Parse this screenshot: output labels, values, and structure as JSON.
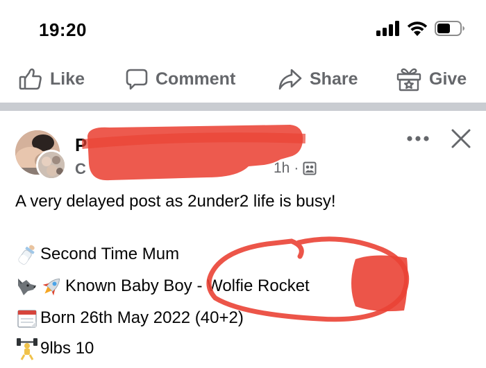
{
  "status_bar": {
    "time": "19:20",
    "icons": [
      "signal-icon",
      "wifi-icon",
      "battery-icon"
    ]
  },
  "actions": {
    "like": "Like",
    "comment": "Comment",
    "share": "Share",
    "give": "Give"
  },
  "post": {
    "author_initial": "P",
    "sub_initial": "C",
    "time": "1h",
    "separator": "·",
    "privacy_icon": "audience-icon",
    "text": "A very delayed post as 2under2 life is busy!",
    "lines": [
      {
        "emoji": "baby-bottle-icon",
        "text": "Second Time Mum"
      },
      {
        "emoji": "wolf-rocket-icon",
        "text": "Known Baby Boy - Wolfie Rocket"
      },
      {
        "emoji": "calendar-icon",
        "text": "Born 26th May 2022 (40+2)"
      },
      {
        "emoji": "weightlifter-icon",
        "text": "9lbs 10"
      }
    ]
  },
  "colors": {
    "text": "#050505",
    "secondary": "#65676b",
    "divider": "#c9ccd1",
    "annotation_red": "#ea4335"
  }
}
